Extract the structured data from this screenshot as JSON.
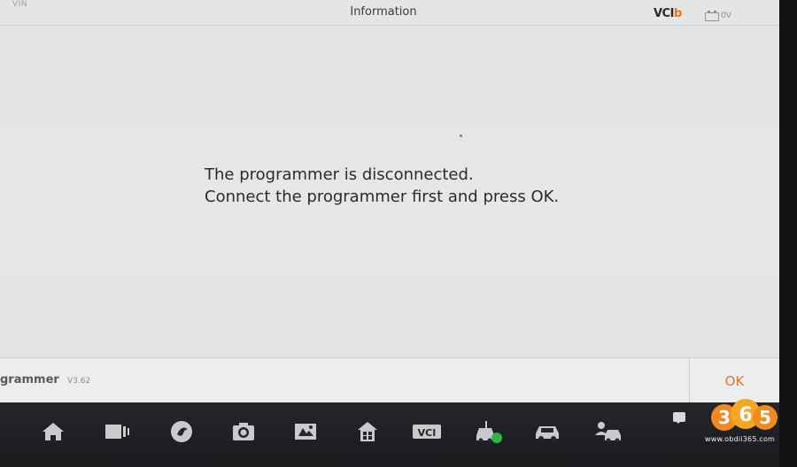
{
  "header": {
    "vin_label": "VIN",
    "title": "Information",
    "vci_logo_main": "VCI",
    "vci_logo_accent": "b",
    "battery_voltage": "0V"
  },
  "dialog": {
    "line1": "The programmer is disconnected.",
    "line2": "Connect the programmer first and press OK."
  },
  "footer": {
    "app_name": "grammer",
    "app_version": "V3.62",
    "ok_label": "OK"
  },
  "taskbar": {
    "icons": [
      "home-icon",
      "recent-apps-icon",
      "browser-icon",
      "camera-icon",
      "display-settings-icon",
      "vci-manager-icon",
      "vci-label-icon",
      "vehicle-connected-icon",
      "car-icon",
      "car-user-icon",
      "chat-icon"
    ],
    "vci_text": "VCI"
  },
  "watermark": {
    "badge_text": "365",
    "url": "www.obdii365.com"
  },
  "colors": {
    "accent_orange": "#e0772e",
    "screen_bg": "#e4e5e5",
    "taskbar_bg": "#1d1e20",
    "status_green": "#2fb34a"
  }
}
